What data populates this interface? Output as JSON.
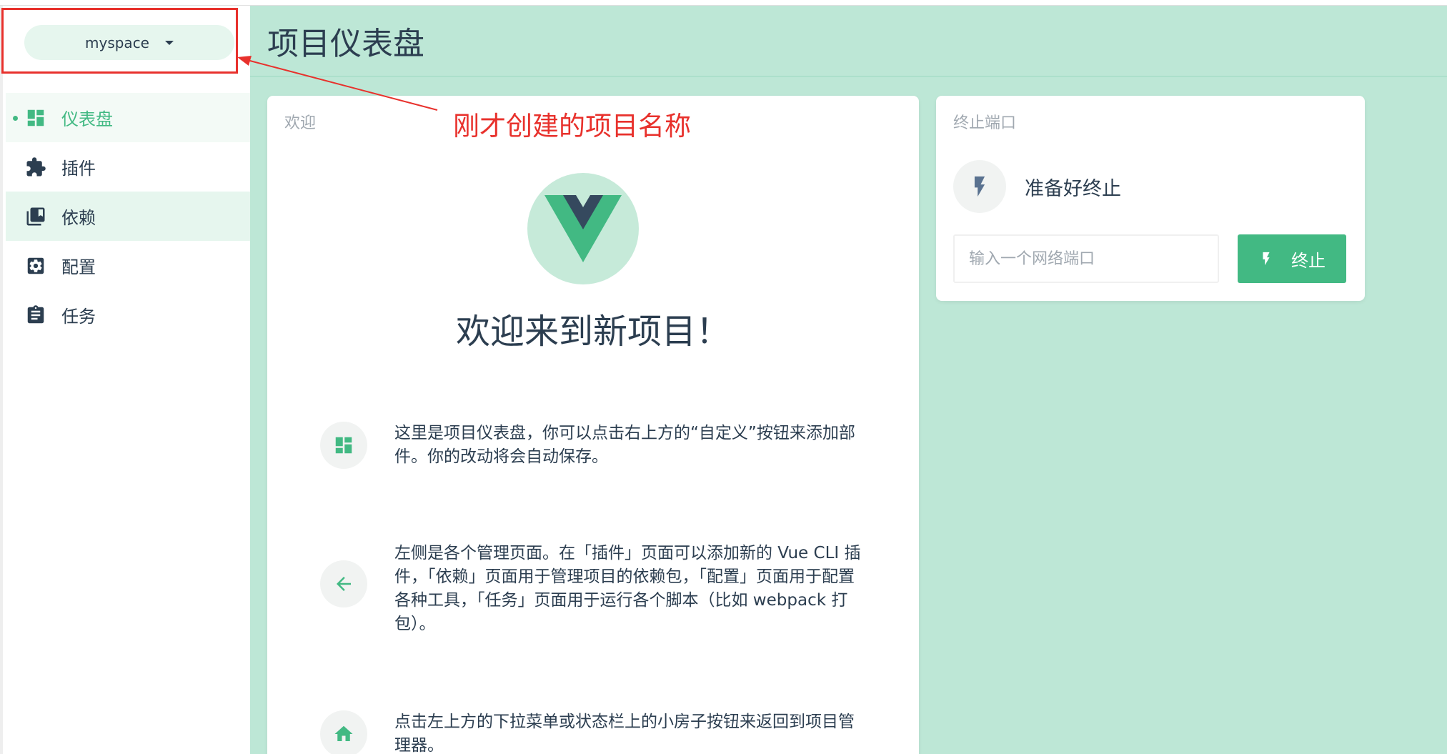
{
  "sidebar": {
    "project_name": "myspace",
    "items": [
      {
        "label": "仪表盘",
        "icon": "dashboard-icon"
      },
      {
        "label": "插件",
        "icon": "puzzle-icon"
      },
      {
        "label": "依赖",
        "icon": "library-icon"
      },
      {
        "label": "配置",
        "icon": "settings-icon"
      },
      {
        "label": "任务",
        "icon": "clipboard-icon"
      }
    ],
    "active_index": 0
  },
  "header": {
    "title": "项目仪表盘"
  },
  "welcome": {
    "card_title": "欢迎",
    "heading": "欢迎来到新项目！",
    "tips": [
      {
        "icon": "dashboard-icon",
        "text": "这里是项目仪表盘，你可以点击右上方的“自定义”按钮来添加部件。你的改动将会自动保存。"
      },
      {
        "icon": "arrow-left-icon",
        "text": "左侧是各个管理页面。在「插件」页面可以添加新的 Vue CLI 插件，「依赖」页面用于管理项目的依赖包，「配置」页面用于配置各种工具，「任务」页面用于运行各个脚本（比如 webpack 打包）。"
      },
      {
        "icon": "home-icon",
        "text": "点击左上方的下拉菜单或状态栏上的小房子按钮来返回到项目管理器。"
      }
    ]
  },
  "kill_port": {
    "card_title": "终止端口",
    "status": "准备好终止",
    "input_placeholder": "输入一个网络端口",
    "button_label": "终止"
  },
  "annotation": {
    "text": "刚才创建的项目名称"
  },
  "colors": {
    "accent": "#42b983",
    "main_bg": "#bde7d6",
    "annotation": "#e8312c",
    "text": "#2c3e50"
  }
}
